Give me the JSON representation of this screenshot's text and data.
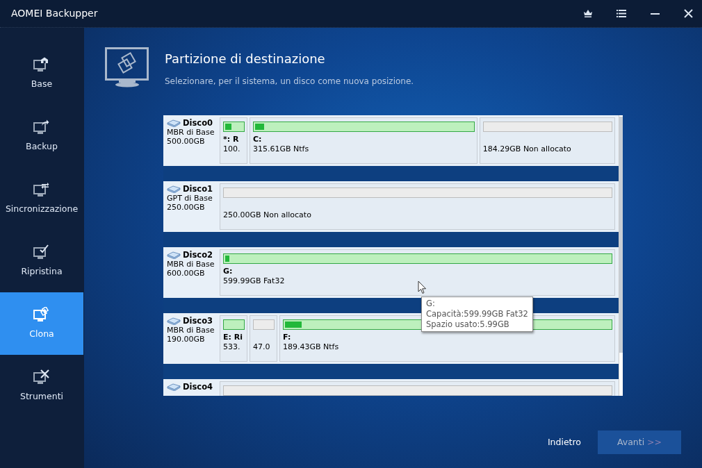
{
  "window": {
    "title": "AOMEI Backupper"
  },
  "sidebar": {
    "items": [
      {
        "label": "Base",
        "selected": false
      },
      {
        "label": "Backup",
        "selected": false
      },
      {
        "label": "Sincronizzazione",
        "selected": false
      },
      {
        "label": "Ripristina",
        "selected": false
      },
      {
        "label": "Clona",
        "selected": true
      },
      {
        "label": "Strumenti",
        "selected": false
      }
    ]
  },
  "header": {
    "title": "Partizione di destinazione",
    "subtitle": "Selezionare, per il sistema, un disco come nuova posizione."
  },
  "disks": [
    {
      "name": "Disco0",
      "type": "MBR di Base",
      "size": "500.00GB",
      "partitions": [
        {
          "kind": "partition",
          "narrow": true,
          "label": "*: R",
          "detail": "100.",
          "level": 0.3
        },
        {
          "kind": "partition",
          "narrow": false,
          "label": "C:",
          "detail": "315.61GB Ntfs",
          "level": 0.04
        },
        {
          "kind": "unallocated",
          "narrow": false,
          "detail": "184.29GB Non allocato"
        }
      ]
    },
    {
      "name": "Disco1",
      "type": "GPT di Base",
      "size": "250.00GB",
      "partitions": [
        {
          "kind": "unallocated",
          "narrow": false,
          "detail": "250.00GB Non allocato"
        }
      ]
    },
    {
      "name": "Disco2",
      "type": "MBR di Base",
      "size": "600.00GB",
      "partitions": [
        {
          "kind": "partition",
          "narrow": false,
          "label": "G:",
          "detail": "599.99GB Fat32",
          "level": 0.01
        }
      ]
    },
    {
      "name": "Disco3",
      "type": "MBR di Base",
      "size": "190.00GB",
      "partitions": [
        {
          "kind": "partition",
          "narrow": true,
          "label": "E: Ri",
          "detail": "533.",
          "level": 0.0
        },
        {
          "kind": "unallocated",
          "narrow": true,
          "detail": "47.0"
        },
        {
          "kind": "partition",
          "narrow": false,
          "label": "F:",
          "detail": "189.43GB Ntfs",
          "level": 0.05
        }
      ]
    },
    {
      "name": "Disco4",
      "partitions": [
        {
          "kind": "unallocated",
          "narrow": false
        }
      ]
    }
  ],
  "tooltip": {
    "lines": [
      "G:",
      "Capacità:599.99GB Fat32",
      "Spazio usato:5.99GB"
    ]
  },
  "buttons": {
    "back": "Indietro",
    "next": "Avanti",
    "next_arrow": ">>",
    "next_disabled": true
  }
}
